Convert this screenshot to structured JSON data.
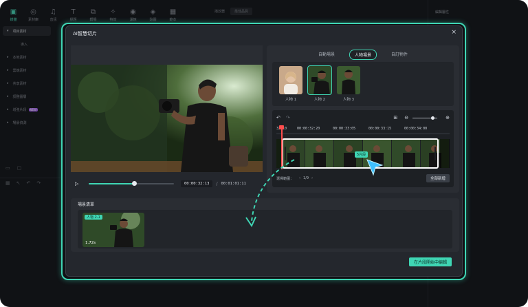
{
  "app": {
    "nav": [
      {
        "label": "媒體",
        "icon": "media-icon",
        "active": true
      },
      {
        "label": "素材庫",
        "icon": "stock-icon"
      },
      {
        "label": "音訊",
        "icon": "audio-icon"
      },
      {
        "label": "標題",
        "icon": "title-icon"
      },
      {
        "label": "轉場",
        "icon": "transition-icon"
      },
      {
        "label": "特效",
        "icon": "effects-icon"
      },
      {
        "label": "濾鏡",
        "icon": "filter-icon"
      },
      {
        "label": "貼圖",
        "icon": "sticker-icon"
      },
      {
        "label": "範本",
        "icon": "template-icon"
      }
    ],
    "sidebar": [
      {
        "label": "項目素材",
        "active": true
      },
      {
        "label": "導入",
        "sub": true
      },
      {
        "label": "本地素材"
      },
      {
        "label": "雲端素材"
      },
      {
        "label": "共享素材"
      },
      {
        "label": "調整圖層"
      },
      {
        "label": "增強片段",
        "badge": "NEW"
      },
      {
        "label": "場景偵測"
      }
    ],
    "top_strip": {
      "label": "播放器",
      "select": "最佳品質"
    },
    "right_title": "編輯屬性"
  },
  "modal": {
    "title": "AI智慧切片",
    "close": "×",
    "tabs": [
      {
        "label": "自動場景",
        "active": false
      },
      {
        "label": "人物場景",
        "active": true
      },
      {
        "label": "自訂物件",
        "active": false
      }
    ],
    "persons": [
      {
        "label": "人物 1",
        "selected": false
      },
      {
        "label": "人物 2",
        "selected": true
      },
      {
        "label": "人物 3",
        "selected": false
      }
    ],
    "player": {
      "progress": 0.53,
      "current": "00:00:32:13",
      "separator": "/",
      "total": "00:01:01:11"
    },
    "editor": {
      "ruler": [
        "32:10",
        "00:00:32:20",
        "00:00:33:05",
        "00:00:33:15",
        "00:00:34:00"
      ],
      "segment_label": "5片段",
      "foot_label": "選擇範圍：",
      "page": "1/9",
      "add_all": "全部新增",
      "zoom": 0.8
    },
    "scene_list": {
      "title": "場景清單",
      "clip_tag": "人物 2-1",
      "clip_duration": "1.72s"
    },
    "confirm": "在片段開始中編輯"
  },
  "colors": {
    "accent": "#3fd6b4",
    "background": "#1a1c21",
    "modal": "#24272d",
    "playhead": "#ff4d4d"
  }
}
